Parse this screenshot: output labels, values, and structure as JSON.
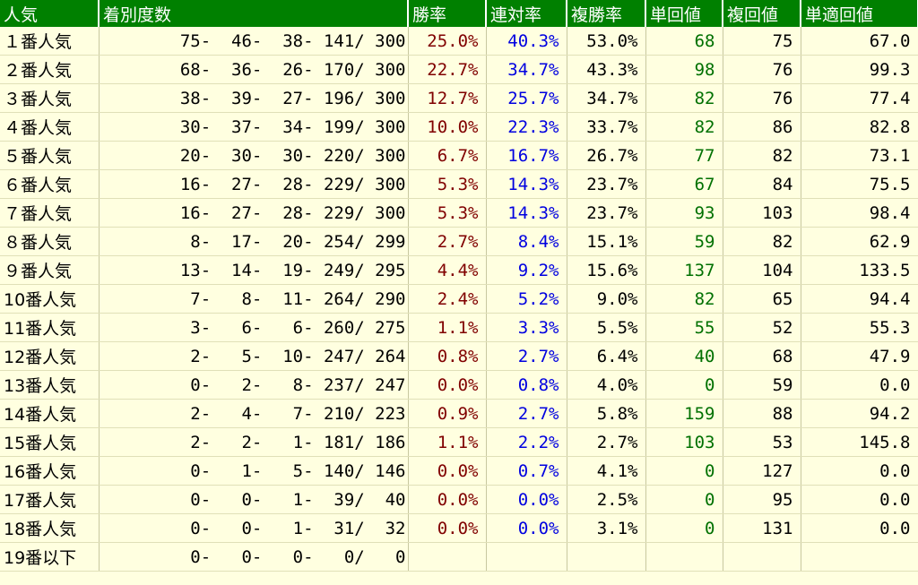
{
  "headers": [
    "人気",
    "着別度数",
    "勝率",
    "連対率",
    "複勝率",
    "単回値",
    "複回値",
    "単適回値"
  ],
  "rows": [
    {
      "pop": "１番人気",
      "record": "75-  46-  38- 141/ 300",
      "win": "25.0%",
      "ren": "40.3%",
      "fuku": "53.0%",
      "tan": "68",
      "fukukai": "75",
      "tanteki": "67.0"
    },
    {
      "pop": "２番人気",
      "record": "68-  36-  26- 170/ 300",
      "win": "22.7%",
      "ren": "34.7%",
      "fuku": "43.3%",
      "tan": "98",
      "fukukai": "76",
      "tanteki": "99.3"
    },
    {
      "pop": "３番人気",
      "record": "38-  39-  27- 196/ 300",
      "win": "12.7%",
      "ren": "25.7%",
      "fuku": "34.7%",
      "tan": "82",
      "fukukai": "76",
      "tanteki": "77.4"
    },
    {
      "pop": "４番人気",
      "record": "30-  37-  34- 199/ 300",
      "win": "10.0%",
      "ren": "22.3%",
      "fuku": "33.7%",
      "tan": "82",
      "fukukai": "86",
      "tanteki": "82.8"
    },
    {
      "pop": "５番人気",
      "record": "20-  30-  30- 220/ 300",
      "win": "6.7%",
      "ren": "16.7%",
      "fuku": "26.7%",
      "tan": "77",
      "fukukai": "82",
      "tanteki": "73.1"
    },
    {
      "pop": "６番人気",
      "record": "16-  27-  28- 229/ 300",
      "win": "5.3%",
      "ren": "14.3%",
      "fuku": "23.7%",
      "tan": "67",
      "fukukai": "84",
      "tanteki": "75.5"
    },
    {
      "pop": "７番人気",
      "record": "16-  27-  28- 229/ 300",
      "win": "5.3%",
      "ren": "14.3%",
      "fuku": "23.7%",
      "tan": "93",
      "fukukai": "103",
      "tanteki": "98.4"
    },
    {
      "pop": "８番人気",
      "record": "8-  17-  20- 254/ 299",
      "win": "2.7%",
      "ren": "8.4%",
      "fuku": "15.1%",
      "tan": "59",
      "fukukai": "82",
      "tanteki": "62.9"
    },
    {
      "pop": "９番人気",
      "record": "13-  14-  19- 249/ 295",
      "win": "4.4%",
      "ren": "9.2%",
      "fuku": "15.6%",
      "tan": "137",
      "fukukai": "104",
      "tanteki": "133.5"
    },
    {
      "pop": "10番人気",
      "record": "7-   8-  11- 264/ 290",
      "win": "2.4%",
      "ren": "5.2%",
      "fuku": "9.0%",
      "tan": "82",
      "fukukai": "65",
      "tanteki": "94.4"
    },
    {
      "pop": "11番人気",
      "record": "3-   6-   6- 260/ 275",
      "win": "1.1%",
      "ren": "3.3%",
      "fuku": "5.5%",
      "tan": "55",
      "fukukai": "52",
      "tanteki": "55.3"
    },
    {
      "pop": "12番人気",
      "record": "2-   5-  10- 247/ 264",
      "win": "0.8%",
      "ren": "2.7%",
      "fuku": "6.4%",
      "tan": "40",
      "fukukai": "68",
      "tanteki": "47.9"
    },
    {
      "pop": "13番人気",
      "record": "0-   2-   8- 237/ 247",
      "win": "0.0%",
      "ren": "0.8%",
      "fuku": "4.0%",
      "tan": "0",
      "fukukai": "59",
      "tanteki": "0.0"
    },
    {
      "pop": "14番人気",
      "record": "2-   4-   7- 210/ 223",
      "win": "0.9%",
      "ren": "2.7%",
      "fuku": "5.8%",
      "tan": "159",
      "fukukai": "88",
      "tanteki": "94.2"
    },
    {
      "pop": "15番人気",
      "record": "2-   2-   1- 181/ 186",
      "win": "1.1%",
      "ren": "2.2%",
      "fuku": "2.7%",
      "tan": "103",
      "fukukai": "53",
      "tanteki": "145.8"
    },
    {
      "pop": "16番人気",
      "record": "0-   1-   5- 140/ 146",
      "win": "0.0%",
      "ren": "0.7%",
      "fuku": "4.1%",
      "tan": "0",
      "fukukai": "127",
      "tanteki": "0.0"
    },
    {
      "pop": "17番人気",
      "record": "0-   0-   1-  39/  40",
      "win": "0.0%",
      "ren": "0.0%",
      "fuku": "2.5%",
      "tan": "0",
      "fukukai": "95",
      "tanteki": "0.0"
    },
    {
      "pop": "18番人気",
      "record": "0-   0-   1-  31/  32",
      "win": "0.0%",
      "ren": "0.0%",
      "fuku": "3.1%",
      "tan": "0",
      "fukukai": "131",
      "tanteki": "0.0"
    },
    {
      "pop": "19番以下",
      "record": "0-   0-   0-   0/   0",
      "win": "",
      "ren": "",
      "fuku": "",
      "tan": "",
      "fukukai": "",
      "tanteki": ""
    }
  ],
  "colors": {
    "header_bg": "#008000",
    "header_text": "#FFFFFF",
    "body_bg": "#FFFFE0",
    "win_rate": "#800000",
    "rentai_rate": "#0000E0",
    "tan_kaishu": "#007000"
  }
}
